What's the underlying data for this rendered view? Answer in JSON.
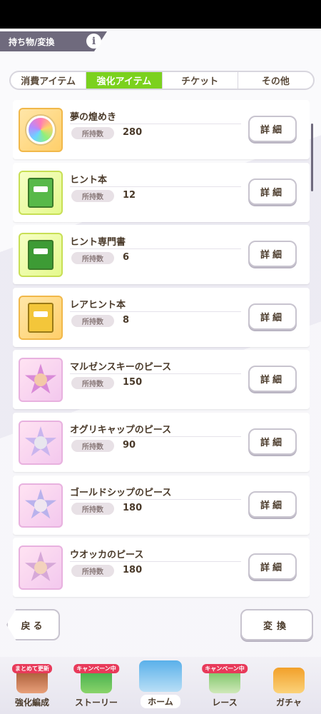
{
  "header": {
    "title": "持ち物/変換",
    "info_icon": "i"
  },
  "tabs": [
    {
      "label": "消費アイテム",
      "active": false
    },
    {
      "label": "強化アイテム",
      "active": true
    },
    {
      "label": "チケット",
      "active": false
    },
    {
      "label": "その他",
      "active": false
    }
  ],
  "items": [
    {
      "name": "夢の煌めき",
      "owned_label": "所持数",
      "count": "280",
      "detail_label": "詳細",
      "icon": "rainbow-gem-icon"
    },
    {
      "name": "ヒント本",
      "owned_label": "所持数",
      "count": "12",
      "detail_label": "詳細",
      "icon": "hint-book-icon"
    },
    {
      "name": "ヒント専門書",
      "owned_label": "所持数",
      "count": "6",
      "detail_label": "詳細",
      "icon": "hint-specialist-book-icon"
    },
    {
      "name": "レアヒント本",
      "owned_label": "所持数",
      "count": "8",
      "detail_label": "詳細",
      "icon": "rare-hint-book-icon"
    },
    {
      "name": "マルゼンスキーのピース",
      "owned_label": "所持数",
      "count": "150",
      "detail_label": "詳細",
      "icon": "character-piece-icon"
    },
    {
      "name": "オグリキャップのピース",
      "owned_label": "所持数",
      "count": "90",
      "detail_label": "詳細",
      "icon": "character-piece-icon"
    },
    {
      "name": "ゴールドシップのピース",
      "owned_label": "所持数",
      "count": "180",
      "detail_label": "詳細",
      "icon": "character-piece-icon"
    },
    {
      "name": "ウオッカのピース",
      "owned_label": "所持数",
      "count": "180",
      "detail_label": "詳細",
      "icon": "character-piece-icon"
    }
  ],
  "footer": {
    "back_label": "戻る",
    "exchange_label": "変換"
  },
  "bottom_nav": [
    {
      "label": "強化編成",
      "badge": "まとめて更新"
    },
    {
      "label": "ストーリー",
      "badge": "キャンペーン中"
    },
    {
      "label": "ホーム",
      "badge": ""
    },
    {
      "label": "レース",
      "badge": "キャンペーン中"
    },
    {
      "label": "ガチャ",
      "badge": ""
    }
  ]
}
